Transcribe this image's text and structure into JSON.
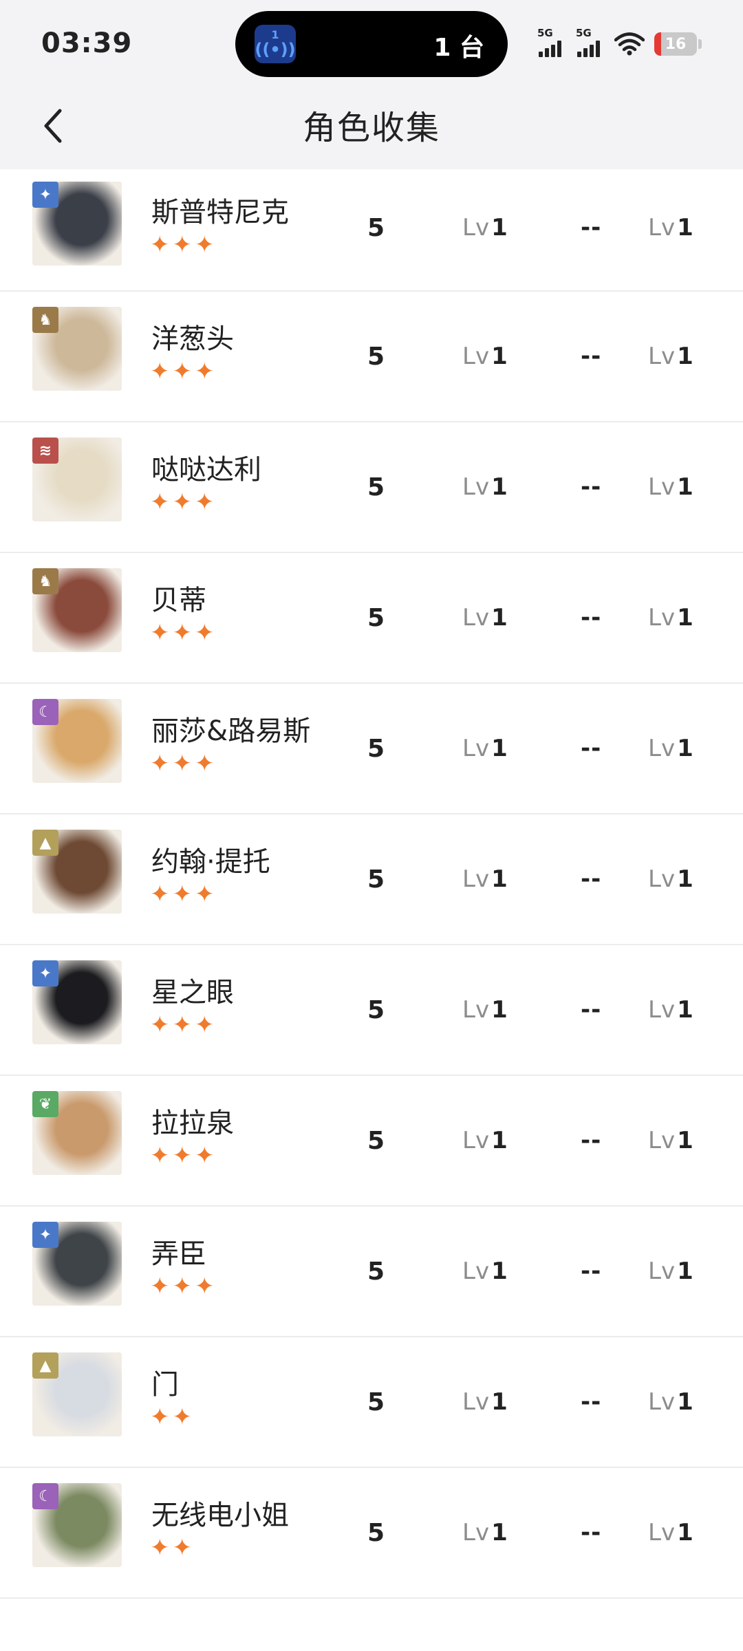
{
  "status_bar": {
    "time": "03:39",
    "island_badge": "1",
    "island_text": "1 台",
    "net1": "5G",
    "net2": "5G",
    "battery": "16"
  },
  "header": {
    "title": "角色收集"
  },
  "colors": {
    "star": "#f07b2d",
    "battery_low": "#e53935"
  },
  "characters": [
    {
      "name": "斯普特尼克",
      "stars": "✦✦✦",
      "rank": "5",
      "lv_prefix": "Lv",
      "lv": "1",
      "middle": "--",
      "lv2_prefix": "Lv",
      "lv2": "1",
      "element_icon": "star-icon",
      "element_color": "#4a78c8",
      "art": "#3b3f48"
    },
    {
      "name": "洋葱头",
      "stars": "✦✦✦",
      "rank": "5",
      "lv_prefix": "Lv",
      "lv": "1",
      "middle": "--",
      "lv2_prefix": "Lv",
      "lv2": "1",
      "element_icon": "beast-icon",
      "element_color": "#9b7a4a",
      "art": "#cdb89a"
    },
    {
      "name": "哒哒达利",
      "stars": "✦✦✦",
      "rank": "5",
      "lv_prefix": "Lv",
      "lv": "1",
      "middle": "--",
      "lv2_prefix": "Lv",
      "lv2": "1",
      "element_icon": "claw-icon",
      "element_color": "#b9504c",
      "art": "#e6dcc6"
    },
    {
      "name": "贝蒂",
      "stars": "✦✦✦",
      "rank": "5",
      "lv_prefix": "Lv",
      "lv": "1",
      "middle": "--",
      "lv2_prefix": "Lv",
      "lv2": "1",
      "element_icon": "beast-icon",
      "element_color": "#9b7a4a",
      "art": "#8a4a3c"
    },
    {
      "name": "丽莎&路易斯",
      "stars": "✦✦✦",
      "rank": "5",
      "lv_prefix": "Lv",
      "lv": "1",
      "middle": "--",
      "lv2_prefix": "Lv",
      "lv2": "1",
      "element_icon": "moon-icon",
      "element_color": "#9a62b8",
      "art": "#d9a86a"
    },
    {
      "name": "约翰·提托",
      "stars": "✦✦✦",
      "rank": "5",
      "lv_prefix": "Lv",
      "lv": "1",
      "middle": "--",
      "lv2_prefix": "Lv",
      "lv2": "1",
      "element_icon": "pyramid-icon",
      "element_color": "#b3a05a",
      "art": "#6e4a34"
    },
    {
      "name": "星之眼",
      "stars": "✦✦✦",
      "rank": "5",
      "lv_prefix": "Lv",
      "lv": "1",
      "middle": "--",
      "lv2_prefix": "Lv",
      "lv2": "1",
      "element_icon": "star-icon",
      "element_color": "#4a78c8",
      "art": "#1c1c20"
    },
    {
      "name": "拉拉泉",
      "stars": "✦✦✦",
      "rank": "5",
      "lv_prefix": "Lv",
      "lv": "1",
      "middle": "--",
      "lv2_prefix": "Lv",
      "lv2": "1",
      "element_icon": "leaf-icon",
      "element_color": "#5aa964",
      "art": "#c99a6c"
    },
    {
      "name": "弄臣",
      "stars": "✦✦✦",
      "rank": "5",
      "lv_prefix": "Lv",
      "lv": "1",
      "middle": "--",
      "lv2_prefix": "Lv",
      "lv2": "1",
      "element_icon": "star-icon",
      "element_color": "#4a78c8",
      "art": "#3f4448"
    },
    {
      "name": "门",
      "stars": "✦✦",
      "rank": "5",
      "lv_prefix": "Lv",
      "lv": "1",
      "middle": "--",
      "lv2_prefix": "Lv",
      "lv2": "1",
      "element_icon": "pyramid-icon",
      "element_color": "#b3a05a",
      "art": "#d7dbe2"
    },
    {
      "name": "无线电小姐",
      "stars": "✦✦",
      "rank": "5",
      "lv_prefix": "Lv",
      "lv": "1",
      "middle": "--",
      "lv2_prefix": "Lv",
      "lv2": "1",
      "element_icon": "moon-icon",
      "element_color": "#9a62b8",
      "art": "#7c8a62"
    }
  ]
}
